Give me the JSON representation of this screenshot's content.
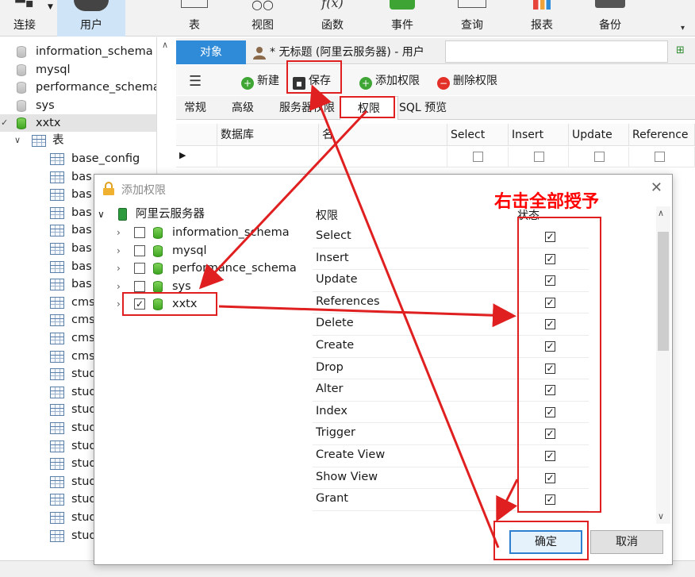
{
  "toolbar": {
    "items": [
      {
        "label": "连接",
        "icon": "connect-icon"
      },
      {
        "label": "用户",
        "icon": "user-icon"
      },
      {
        "label": "表",
        "icon": "table-icon"
      },
      {
        "label": "视图",
        "icon": "view-icon"
      },
      {
        "label": "函数",
        "icon": "function-icon",
        "glyph": "f(x)"
      },
      {
        "label": "事件",
        "icon": "event-icon"
      },
      {
        "label": "查询",
        "icon": "query-icon"
      },
      {
        "label": "报表",
        "icon": "report-icon"
      },
      {
        "label": "备份",
        "icon": "backup-icon"
      }
    ]
  },
  "left_tree": {
    "databases": [
      "information_schema",
      "mysql",
      "performance_schema",
      "sys",
      "xxtx"
    ],
    "tables_node": "表",
    "tables": [
      "base_config",
      "bas",
      "bas",
      "bas",
      "bas",
      "bas",
      "bas",
      "bas",
      "cms",
      "cms",
      "cms",
      "cms",
      "stud",
      "stud",
      "stud",
      "stud",
      "stud",
      "stud",
      "stud",
      "stud",
      "stud",
      "stud"
    ]
  },
  "tabs": {
    "objects": "对象",
    "document": "* 无标题 (阿里云服务器) - 用户"
  },
  "edit_toolbar": {
    "new": "新建",
    "save": "保存",
    "add_privilege": "添加权限",
    "delete_privilege": "删除权限"
  },
  "sub_tabs": [
    "常规",
    "高级",
    "服务器权限",
    "权限",
    "SQL 预览"
  ],
  "grid": {
    "columns": [
      "数据库",
      "名",
      "Select",
      "Insert",
      "Update",
      "Reference"
    ]
  },
  "dialog": {
    "title": "添加权限",
    "server": "阿里云服务器",
    "databases": [
      {
        "name": "information_schema",
        "checked": false
      },
      {
        "name": "mysql",
        "checked": false
      },
      {
        "name": "performance_schema",
        "checked": false
      },
      {
        "name": "sys",
        "checked": false
      },
      {
        "name": "xxtx",
        "checked": true
      }
    ],
    "perm_header": "权限",
    "status_header": "状态",
    "permissions": [
      "Select",
      "Insert",
      "Update",
      "References",
      "Delete",
      "Create",
      "Drop",
      "Alter",
      "Index",
      "Trigger",
      "Create View",
      "Show View",
      "Grant"
    ],
    "ok": "确定",
    "cancel": "取消"
  },
  "annotation": {
    "text": "右击全部授予",
    "color": "#ff0000"
  },
  "colors": {
    "accent": "#2f8bd8",
    "selected_toolbar": "#cfe4f7",
    "annotation": "#e02020"
  }
}
